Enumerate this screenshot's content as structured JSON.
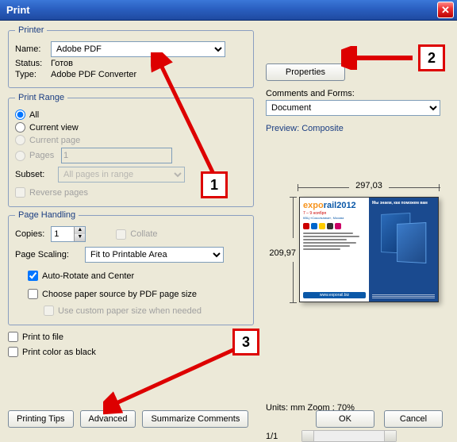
{
  "window": {
    "title": "Print"
  },
  "printer": {
    "legend": "Printer",
    "name_label": "Name:",
    "name_value": "Adobe PDF",
    "status_label": "Status:",
    "status_value": "Готов",
    "type_label": "Type:",
    "type_value": "Adobe PDF Converter",
    "properties_btn": "Properties",
    "comments_label": "Comments and Forms:",
    "comments_value": "Document"
  },
  "range": {
    "legend": "Print Range",
    "all": "All",
    "current_view": "Current view",
    "current_page": "Current page",
    "pages": "Pages",
    "pages_value": "1",
    "subset_label": "Subset:",
    "subset_value": "All pages in range",
    "reverse": "Reverse pages"
  },
  "handling": {
    "legend": "Page Handling",
    "copies_label": "Copies:",
    "copies_value": "1",
    "collate": "Collate",
    "scaling_label": "Page Scaling:",
    "scaling_value": "Fit to Printable Area",
    "autorotate": "Auto-Rotate and Center",
    "choose_source": "Choose paper source by PDF page size",
    "use_custom": "Use custom paper size when needed"
  },
  "options": {
    "print_to_file": "Print to file",
    "print_black": "Print color as black"
  },
  "preview": {
    "title": "Preview: Composite",
    "width": "297,03",
    "height": "209,97",
    "units_line": "Units: mm Zoom :   70%",
    "page_indicator": "1/1",
    "thumb_logo": "exporail2012",
    "thumb_sub": "7 – 9 ноября",
    "thumb_url": "www.exporail.biz",
    "thumb_right_title": "Мы знаем, как поможем вам"
  },
  "buttons": {
    "printing_tips": "Printing Tips",
    "advanced": "Advanced",
    "summarize": "Summarize Comments",
    "ok": "OK",
    "cancel": "Cancel"
  },
  "annotations": {
    "n1": "1",
    "n2": "2",
    "n3": "3"
  }
}
